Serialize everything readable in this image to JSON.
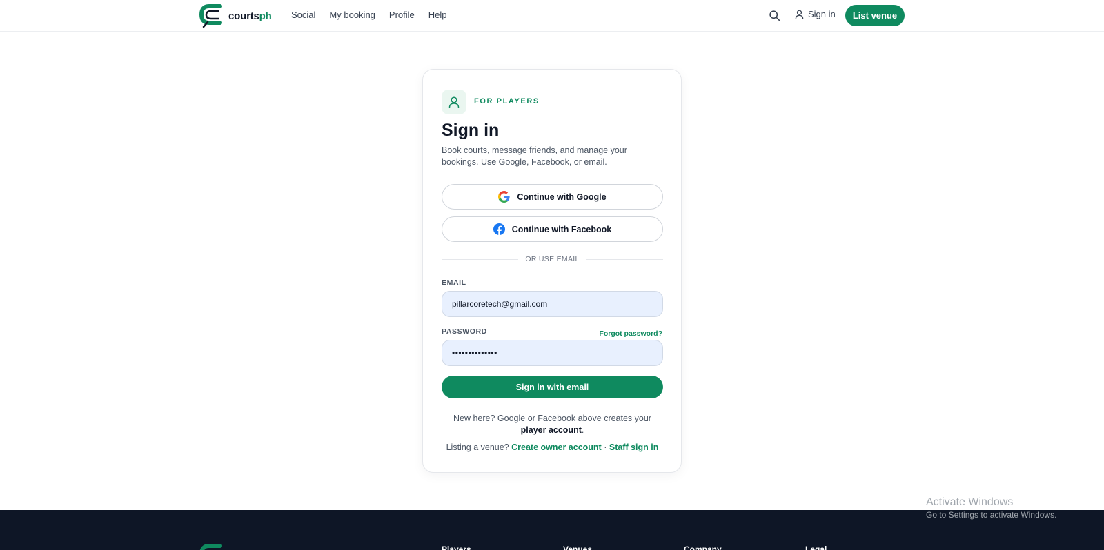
{
  "header": {
    "logo": {
      "text_main": "courts",
      "text_accent": "ph"
    },
    "nav": [
      {
        "label": "Social"
      },
      {
        "label": "My booking"
      },
      {
        "label": "Profile"
      },
      {
        "label": "Help"
      }
    ],
    "sign_in_label": "Sign in",
    "list_venue_label": "List venue"
  },
  "card": {
    "badge_label": "FOR PLAYERS",
    "title": "Sign in",
    "subtitle": "Book courts, message friends, and manage your bookings. Use Google, Facebook, or email.",
    "google_label": "Continue with Google",
    "facebook_label": "Continue with Facebook",
    "divider_label": "OR USE EMAIL",
    "email_label": "EMAIL",
    "email_value": "pillarcoretech@gmail.com",
    "password_label": "PASSWORD",
    "forgot_label": "Forgot password?",
    "password_value": "••••••••••••••",
    "submit_label": "Sign in with email",
    "note_prefix": "New here? Google or Facebook above creates your",
    "note_bold": "player account",
    "note_suffix": ".",
    "owner_prefix": "Listing a venue?",
    "owner_link": "Create owner account",
    "separator": "·",
    "staff_link": "Staff sign in"
  },
  "footer": {
    "columns": [
      "Players",
      "Venues",
      "Company",
      "Legal"
    ]
  },
  "watermark": {
    "line1": "Activate Windows",
    "line2": "Go to Settings to activate Windows."
  },
  "colors": {
    "brand": "#0f8a5f",
    "footer_bg": "#0e1626",
    "input_bg": "#e8f0fe"
  }
}
